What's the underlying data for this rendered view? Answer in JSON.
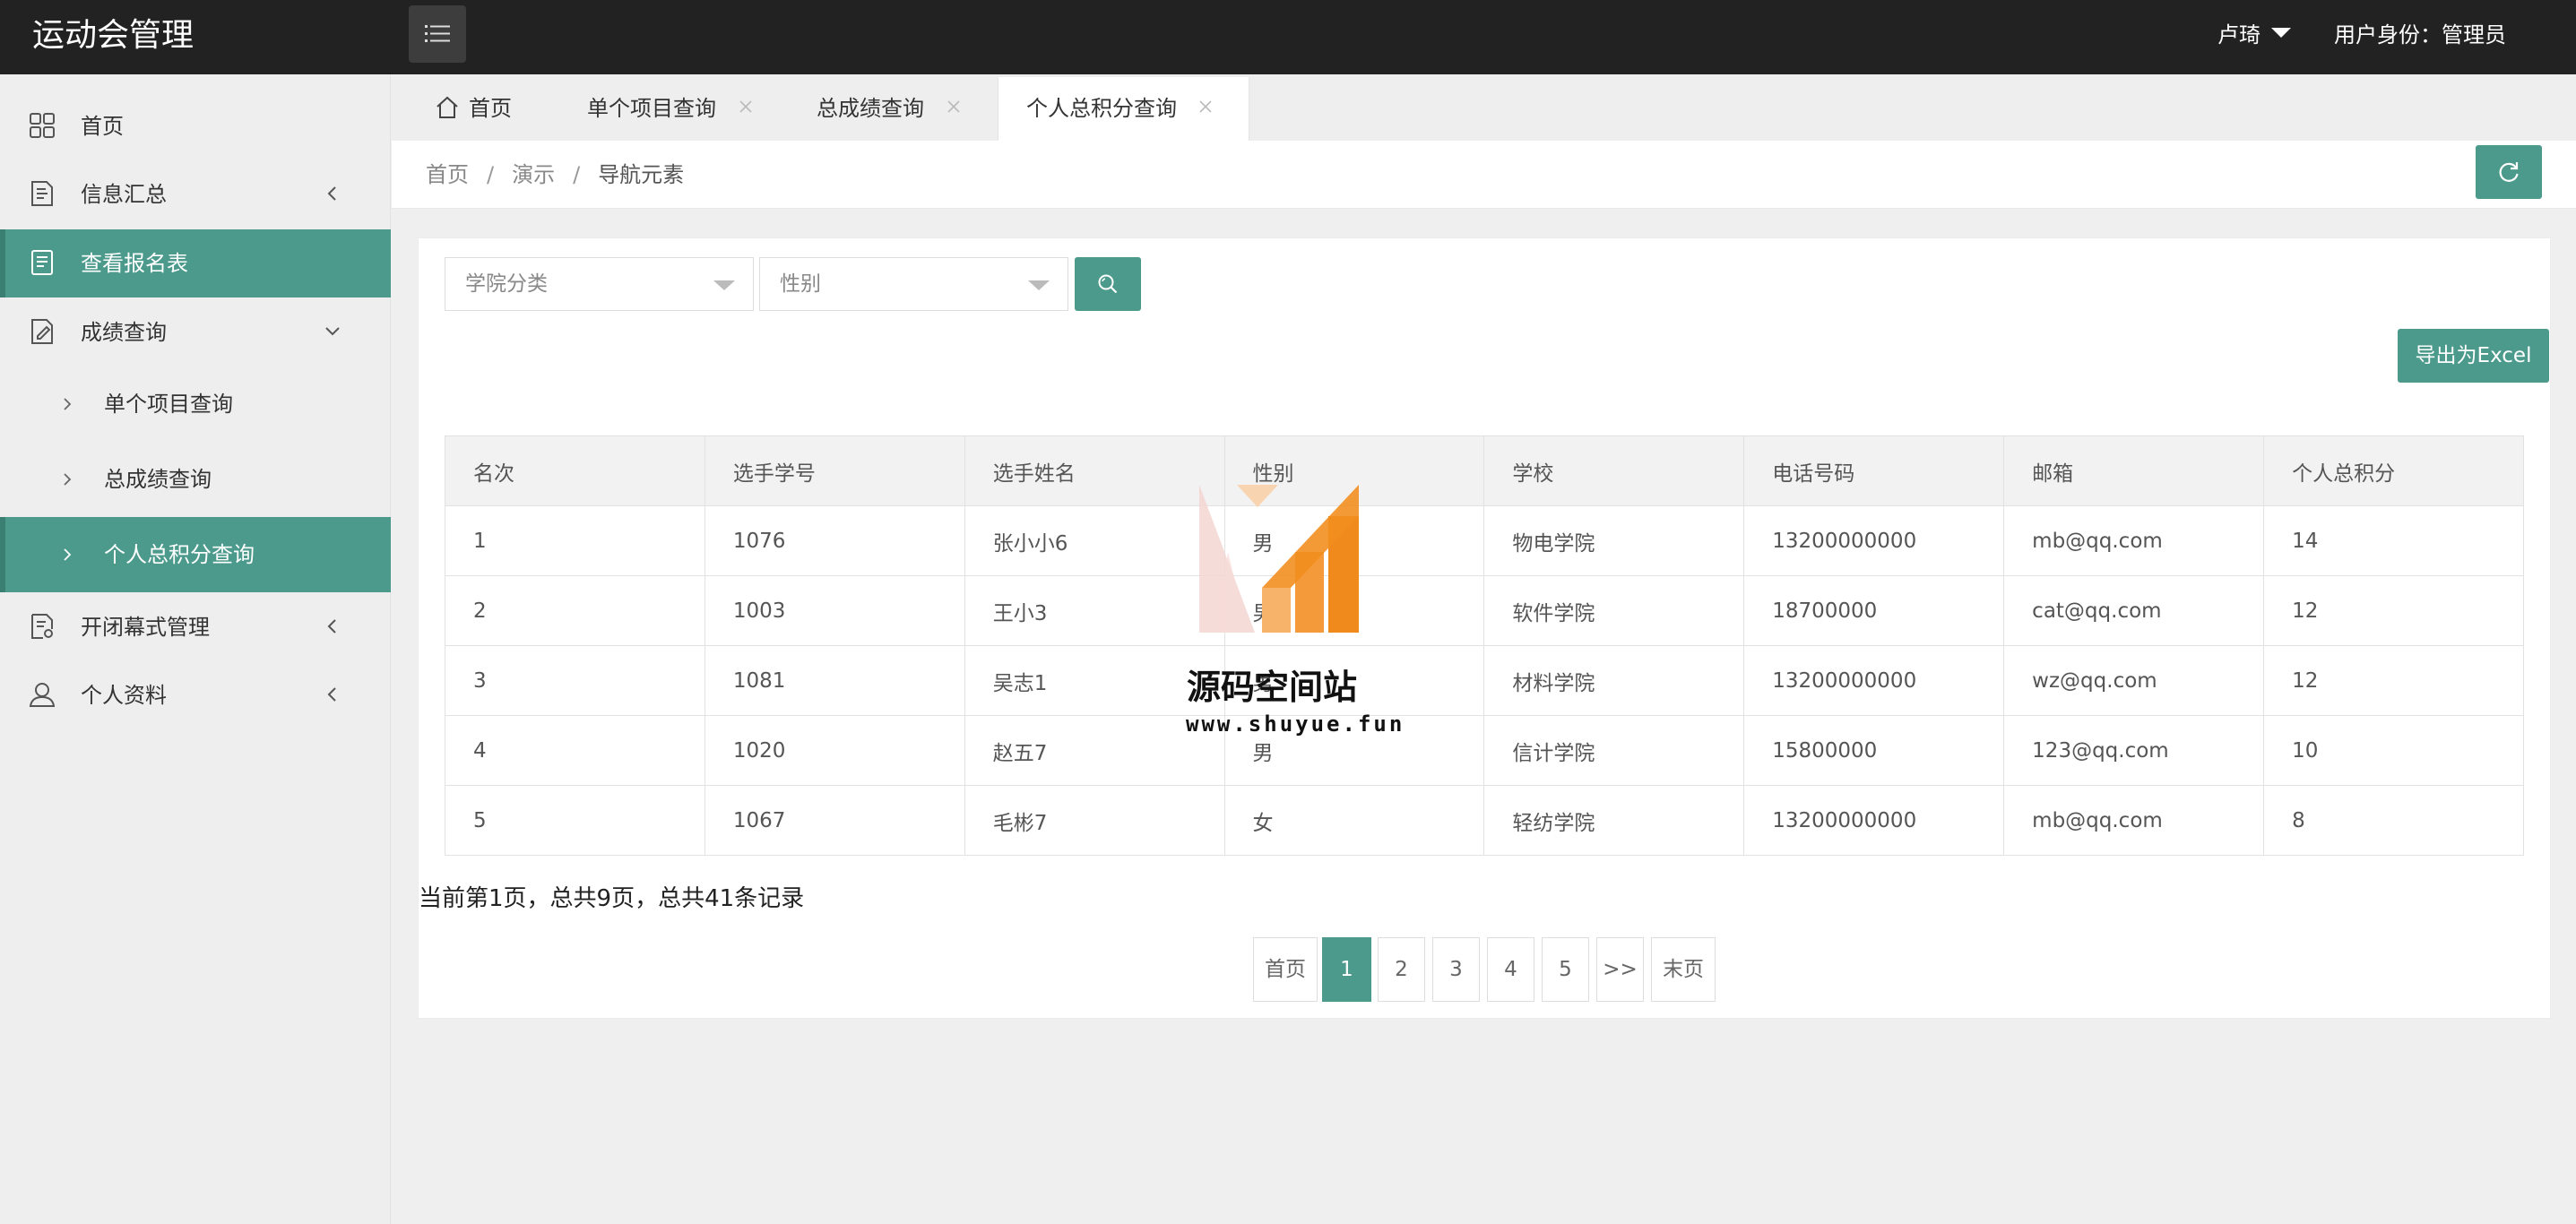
{
  "header": {
    "title": "运动会管理",
    "user_name": "卢琦",
    "user_role": "用户身份：管理员"
  },
  "sidebar": {
    "items": [
      {
        "label": "首页",
        "icon": "grid-icon"
      },
      {
        "label": "信息汇总",
        "icon": "document-icon"
      },
      {
        "label": "查看报名表",
        "icon": "form-icon"
      },
      {
        "label": "成绩查询",
        "icon": "edit-document-icon"
      },
      {
        "label": "开闭幕式管理",
        "icon": "document-settings-icon"
      },
      {
        "label": "个人资料",
        "icon": "user-icon"
      }
    ],
    "sub_items": [
      {
        "label": "单个项目查询"
      },
      {
        "label": "总成绩查询"
      },
      {
        "label": "个人总积分查询"
      }
    ]
  },
  "tabs": [
    {
      "label": "首页"
    },
    {
      "label": "单个项目查询"
    },
    {
      "label": "总成绩查询"
    },
    {
      "label": "个人总积分查询"
    }
  ],
  "breadcrumb": {
    "items": [
      "首页",
      "演示",
      "导航元素"
    ],
    "separator": "/"
  },
  "filters": {
    "college_placeholder": "学院分类",
    "gender_placeholder": "性别"
  },
  "export_label": "导出为Excel",
  "table": {
    "headers": [
      "名次",
      "选手学号",
      "选手姓名",
      "性别",
      "学校",
      "电话号码",
      "邮箱",
      "个人总积分"
    ],
    "rows": [
      [
        "1",
        "1076",
        "张小小6",
        "男",
        "物电学院",
        "13200000000",
        "mb@qq.com",
        "14"
      ],
      [
        "2",
        "1003",
        "王小3",
        "男",
        "软件学院",
        "18700000",
        "cat@qq.com",
        "12"
      ],
      [
        "3",
        "1081",
        "吴志1",
        "男",
        "材料学院",
        "13200000000",
        "wz@qq.com",
        "12"
      ],
      [
        "4",
        "1020",
        "赵五7",
        "男",
        "信计学院",
        "15800000",
        "123@qq.com",
        "10"
      ],
      [
        "5",
        "1067",
        "毛彬7",
        "女",
        "轻纺学院",
        "13200000000",
        "mb@qq.com",
        "8"
      ]
    ]
  },
  "page_info": "当前第1页，总共9页，总共41条记录",
  "pagination": {
    "first": "首页",
    "pages": [
      "1",
      "2",
      "3",
      "4",
      "5"
    ],
    "current": "1",
    "next": ">>",
    "last": "末页"
  },
  "watermark": {
    "name": "源码空间站",
    "url": "www.shuyue.fun"
  },
  "colors": {
    "accent": "#4b9a8c",
    "header_bg": "#222222"
  }
}
